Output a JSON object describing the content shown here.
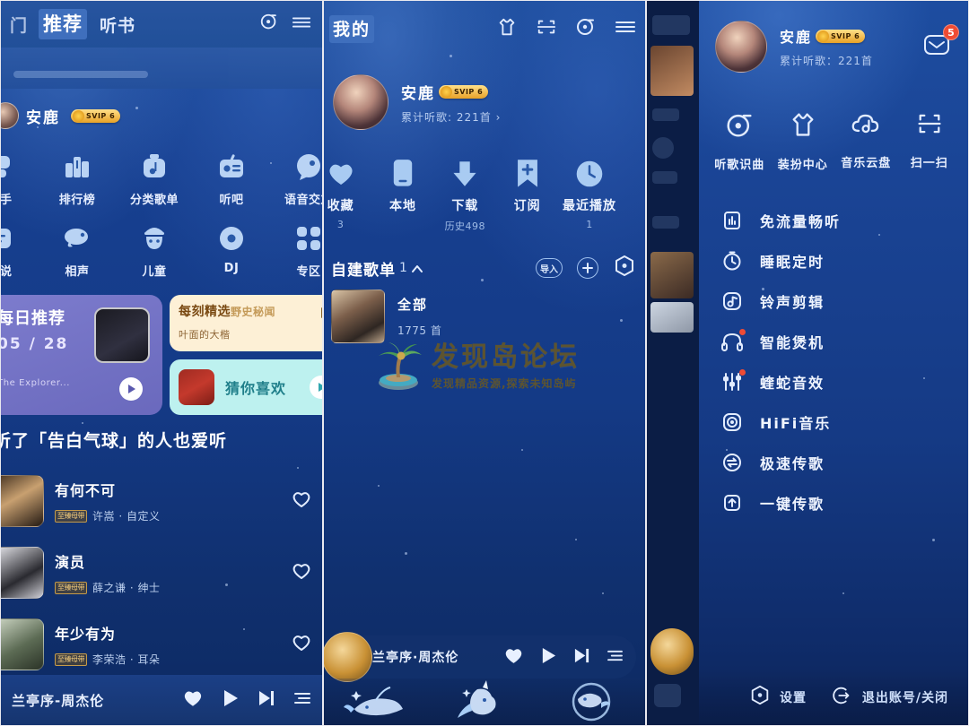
{
  "panel1": {
    "tabs": [
      {
        "label": "门",
        "active": false,
        "cut": true
      },
      {
        "label": "推荐",
        "active": true,
        "cut": false
      },
      {
        "label": "听书",
        "active": false,
        "cut": false
      }
    ],
    "top_icons": [
      "mic-record-icon",
      "menu-icon"
    ],
    "user": {
      "name": "安鹿",
      "vip_badge": "SVIP 6"
    },
    "grid": [
      [
        {
          "label": "歌手",
          "icon": "singer-icon"
        },
        {
          "label": "排行榜",
          "icon": "chart-rank-icon"
        },
        {
          "label": "分类歌单",
          "icon": "playlist-category-icon"
        },
        {
          "label": "听吧",
          "icon": "radio-icon"
        },
        {
          "label": "语音交友",
          "icon": "voice-chat-icon"
        }
      ],
      [
        {
          "label": "小说",
          "icon": "novel-icon"
        },
        {
          "label": "相声",
          "icon": "crosstalk-icon"
        },
        {
          "label": "儿童",
          "icon": "kids-icon"
        },
        {
          "label": "DJ",
          "icon": "dj-disc-icon"
        },
        {
          "label": "专区",
          "icon": "zone-grid-icon"
        }
      ]
    ],
    "daily_card": {
      "title": "每日推荐",
      "date": "05 / 28",
      "subtitle": "The Explorer..."
    },
    "cream_card": {
      "title": "每刻精选",
      "tag": "野史秘闻",
      "subtitle": "叶面的大楷"
    },
    "cyan_card": {
      "title": "猜你喜欢"
    },
    "section_heading": "听了「告白气球」的人也爱听",
    "songs": [
      {
        "name": "有何不可",
        "badge": "至臻母带",
        "artist": "许嵩 · 自定义"
      },
      {
        "name": "演员",
        "badge": "至臻母带",
        "artist": "薛之谦 · 绅士"
      },
      {
        "name": "年少有为",
        "badge": "至臻母带",
        "artist": "李荣浩 · 耳朵"
      }
    ],
    "player": {
      "title": "兰亭序-周杰伦"
    }
  },
  "panel2": {
    "title": "我的",
    "top_icons": [
      "tshirt-skin-icon",
      "scan-icon",
      "mic-record-icon",
      "menu-icon"
    ],
    "user": {
      "name": "安鹿",
      "vip_badge": "SVIP 6",
      "stats": "累计听歌: 221首 ›"
    },
    "quick": [
      {
        "label": "收藏",
        "count": "3",
        "icon": "heart-icon"
      },
      {
        "label": "本地",
        "count": "",
        "icon": "phone-local-icon"
      },
      {
        "label": "下载",
        "count": "历史498",
        "icon": "download-icon"
      },
      {
        "label": "订阅",
        "count": "",
        "icon": "bookmark-plus-icon"
      },
      {
        "label": "最近播放",
        "count": "1",
        "icon": "clock-icon"
      }
    ],
    "playlist_header": {
      "title": "自建歌单",
      "count": "1",
      "actions": [
        "导入",
        "add-icon",
        "settings-hex-icon"
      ]
    },
    "playlist_row": {
      "title": "全部",
      "count": "1775 首"
    },
    "watermark": {
      "main": "发现岛论坛",
      "sub": "发现精品资源,探索未知岛屿",
      "icon": "palm-island-icon"
    },
    "player": {
      "title": "兰亭序·周杰伦"
    },
    "tabbar": [
      "whale-icon",
      "unicorn-icon",
      "fish-circle-icon"
    ]
  },
  "panel3": {
    "user": {
      "name": "安鹿",
      "vip_badge": "SVIP 6",
      "stats": "累计听歌：221首"
    },
    "message_badge": "5",
    "quad": [
      {
        "label": "听歌识曲",
        "icon": "mic-record-icon"
      },
      {
        "label": "装扮中心",
        "icon": "tshirt-skin-icon"
      },
      {
        "label": "音乐云盘",
        "icon": "cloud-music-icon"
      },
      {
        "label": "扫一扫",
        "icon": "scan-icon"
      }
    ],
    "menu": [
      {
        "label": "免流量畅听",
        "icon": "data-free-icon",
        "dot": false
      },
      {
        "label": "睡眠定时",
        "icon": "timer-icon",
        "dot": false
      },
      {
        "label": "铃声剪辑",
        "icon": "ringtone-cut-icon",
        "dot": false
      },
      {
        "label": "智能煲机",
        "icon": "headphone-burn-icon",
        "dot": true
      },
      {
        "label": "蝰蛇音效",
        "icon": "equalizer-icon",
        "dot": true
      },
      {
        "label": "HiFi音乐",
        "icon": "hifi-icon",
        "dot": false
      },
      {
        "label": "极速传歌",
        "icon": "fast-transfer-icon",
        "dot": false
      },
      {
        "label": "一键传歌",
        "icon": "one-key-transfer-icon",
        "dot": false
      }
    ],
    "bottom": [
      {
        "label": "设置",
        "icon": "settings-hex-icon"
      },
      {
        "label": "退出账号/关闭",
        "icon": "logout-icon"
      }
    ]
  },
  "colors": {
    "brand_blue": "#1b4b9b",
    "accent_purple": "#6a69bd",
    "accent_cream": "#fdf0d6",
    "accent_cyan": "#bdf1ef",
    "badge_red": "#ef4b34",
    "vip_gold": "#e8a227"
  }
}
